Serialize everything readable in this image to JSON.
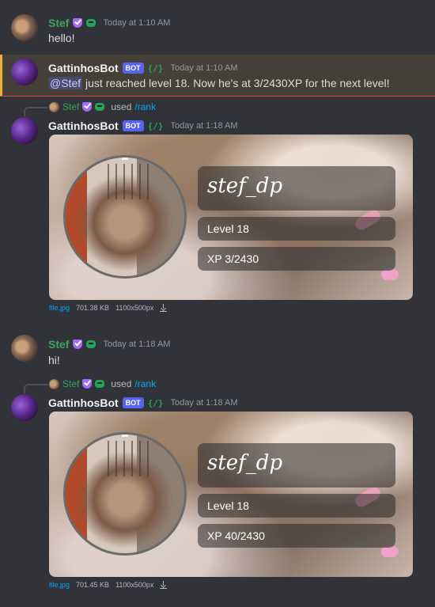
{
  "messages": {
    "m1": {
      "author": "Stef",
      "timestamp": "Today at 1:10 AM",
      "text": "hello!"
    },
    "m2": {
      "author": "GattinhosBot",
      "bot_tag": "BOT",
      "slash_badge": "{/}",
      "timestamp": "Today at 1:10 AM",
      "mention": "@Stef",
      "text": " just reached level 18. Now he's at 3/2430XP for the next level!"
    },
    "m3": {
      "reply_name": "Stef",
      "reply_used": "used",
      "reply_cmd": "/rank",
      "author": "GattinhosBot",
      "bot_tag": "BOT",
      "slash_badge": "{/}",
      "timestamp": "Today at 1:18 AM",
      "card": {
        "username": "stef_dp",
        "level": "Level 18",
        "xp": "XP 3/2430"
      },
      "file": {
        "name": "file.jpg",
        "size": "701.38 KB",
        "dims": "1100x500px"
      }
    },
    "m4": {
      "author": "Stef",
      "timestamp": "Today at 1:18 AM",
      "text": "hi!"
    },
    "m5": {
      "reply_name": "Stef",
      "reply_used": "used",
      "reply_cmd": "/rank",
      "author": "GattinhosBot",
      "bot_tag": "BOT",
      "slash_badge": "{/}",
      "timestamp": "Today at 1:18 AM",
      "card": {
        "username": "stef_dp",
        "level": "Level 18",
        "xp": "XP 40/2430"
      },
      "file": {
        "name": "file.jpg",
        "size": "701.45 KB",
        "dims": "1100x500px"
      }
    }
  },
  "colors": {
    "background": "#313338",
    "stef_name": "#3ba55c",
    "bot_tag": "#5865f2",
    "mention_highlight": "#f0b132",
    "link": "#00a8fc"
  },
  "icons": {
    "shield": "shield-icon",
    "game": "game-controller-icon",
    "download": "download-icon"
  }
}
